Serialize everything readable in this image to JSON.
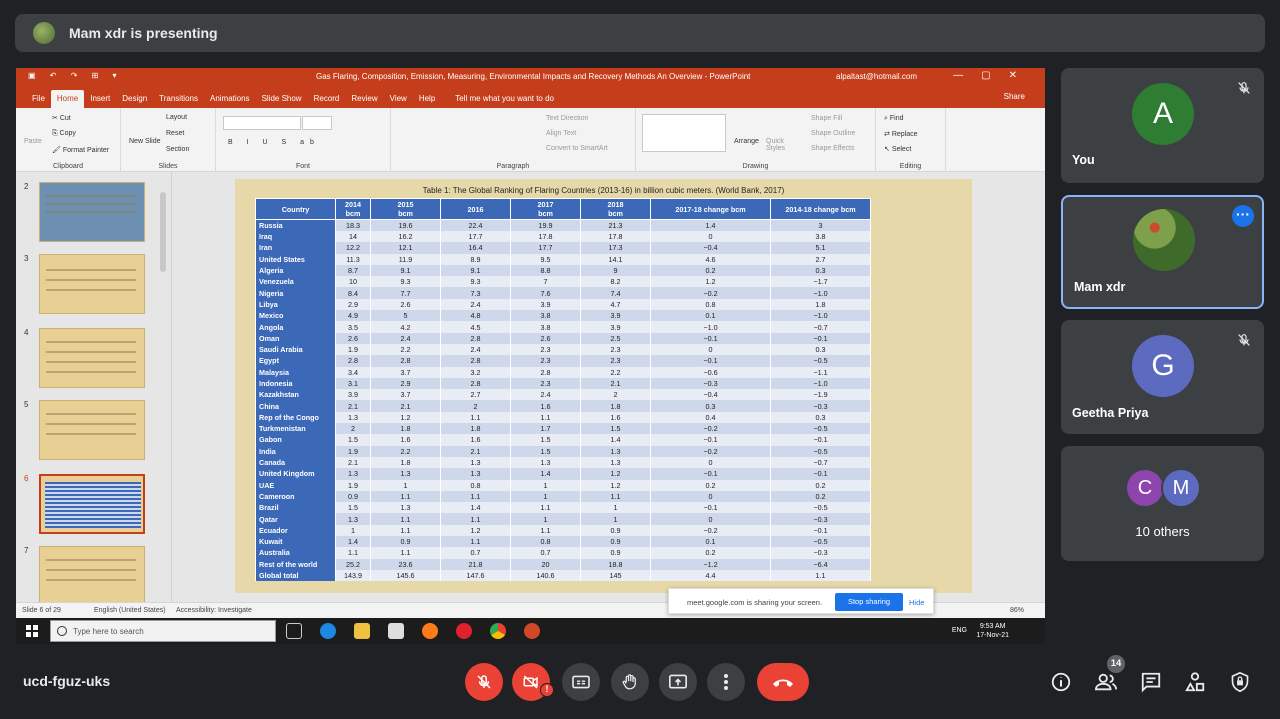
{
  "presenting": {
    "text": "Mam xdr is presenting"
  },
  "ppt": {
    "window_title": "Gas Flaring, Composition, Emission, Measuring, Environmental Impacts and Recovery Methods An Overview  -  PowerPoint",
    "account": "alpaltast@hotmail.com",
    "tabs": [
      "File",
      "Home",
      "Insert",
      "Design",
      "Transitions",
      "Animations",
      "Slide Show",
      "Record",
      "Review",
      "View",
      "Help"
    ],
    "active_tab": "Home",
    "tell_me": "Tell me what you want to do",
    "share": "Share",
    "ribbon": {
      "clipboard": {
        "label": "Clipboard",
        "paste": "Paste",
        "cut": "Cut",
        "copy": "Copy",
        "format_painter": "Format Painter"
      },
      "slides": {
        "label": "Slides",
        "new_slide": "New Slide",
        "layout": "Layout",
        "reset": "Reset",
        "section": "Section"
      },
      "font": {
        "label": "Font"
      },
      "paragraph": {
        "label": "Paragraph",
        "text_direction": "Text Direction",
        "align_text": "Align Text",
        "smartart": "Convert to SmartArt"
      },
      "drawing": {
        "label": "Drawing",
        "arrange": "Arrange",
        "quick_styles": "Quick Styles",
        "shape_fill": "Shape Fill",
        "shape_outline": "Shape Outline",
        "shape_effects": "Shape Effects"
      },
      "editing": {
        "label": "Editing",
        "find": "Find",
        "replace": "Replace",
        "select": "Select"
      }
    },
    "thumbnails": [
      {
        "num": "2"
      },
      {
        "num": "3"
      },
      {
        "num": "4"
      },
      {
        "num": "5"
      },
      {
        "num": "6"
      },
      {
        "num": "7"
      }
    ],
    "selected_slide": "6",
    "status": {
      "slide": "Slide 6 of 29",
      "language": "English (United States)",
      "accessibility": "Accessibility: Investigate",
      "zoom": "86%"
    }
  },
  "slide": {
    "table_title": "Table 1: The Global Ranking of Flaring Countries (2013-16) in billion cubic meters. (World Bank, 2017)",
    "headers": [
      "Country",
      "2014\nbcm",
      "2015\nbcm",
      "2016",
      "2017\nbcm",
      "2018\nbcm",
      "2017-18 change bcm",
      "2014-18 change bcm"
    ],
    "rows": [
      [
        "Russia",
        "18.3",
        "19.6",
        "22.4",
        "19.9",
        "21.3",
        "1.4",
        "3"
      ],
      [
        "Iraq",
        "14",
        "16.2",
        "17.7",
        "17.8",
        "17.8",
        "0",
        "3.8"
      ],
      [
        "Iran",
        "12.2",
        "12.1",
        "16.4",
        "17.7",
        "17.3",
        "−0.4",
        "5.1"
      ],
      [
        "United States",
        "11.3",
        "11.9",
        "8.9",
        "9.5",
        "14.1",
        "4.6",
        "2.7"
      ],
      [
        "Algeria",
        "8.7",
        "9.1",
        "9.1",
        "8.8",
        "9",
        "0.2",
        "0.3"
      ],
      [
        "Venezuela",
        "10",
        "9.3",
        "9.3",
        "7",
        "8.2",
        "1.2",
        "−1.7"
      ],
      [
        "Nigeria",
        "8.4",
        "7.7",
        "7.3",
        "7.6",
        "7.4",
        "−0.2",
        "−1.0"
      ],
      [
        "Libya",
        "2.9",
        "2.6",
        "2.4",
        "3.9",
        "4.7",
        "0.8",
        "1.8"
      ],
      [
        "Mexico",
        "4.9",
        "5",
        "4.8",
        "3.8",
        "3.9",
        "0.1",
        "−1.0"
      ],
      [
        "Angola",
        "3.5",
        "4.2",
        "4.5",
        "3.8",
        "3.9",
        "−1.0",
        "−0.7"
      ],
      [
        "Oman",
        "2.6",
        "2.4",
        "2.8",
        "2.6",
        "2.5",
        "−0.1",
        "−0.1"
      ],
      [
        "Saudi Arabia",
        "1.9",
        "2.2",
        "2.4",
        "2.3",
        "2.3",
        "0",
        "0.3"
      ],
      [
        "Egypt",
        "2.8",
        "2.8",
        "2.8",
        "2.3",
        "2.3",
        "−0.1",
        "−0.5"
      ],
      [
        "Malaysia",
        "3.4",
        "3.7",
        "3.2",
        "2.8",
        "2.2",
        "−0.6",
        "−1.1"
      ],
      [
        "Indonesia",
        "3.1",
        "2.9",
        "2.8",
        "2.3",
        "2.1",
        "−0.3",
        "−1.0"
      ],
      [
        "Kazakhstan",
        "3.9",
        "3.7",
        "2.7",
        "2.4",
        "2",
        "−0.4",
        "−1.9"
      ],
      [
        "China",
        "2.1",
        "2.1",
        "2",
        "1.6",
        "1.8",
        "0.3",
        "−0.3"
      ],
      [
        "Rep of the Congo",
        "1.3",
        "1.2",
        "1.1",
        "1.1",
        "1.6",
        "0.4",
        "0.3"
      ],
      [
        "Turkmenistan",
        "2",
        "1.8",
        "1.8",
        "1.7",
        "1.5",
        "−0.2",
        "−0.5"
      ],
      [
        "Gabon",
        "1.5",
        "1.6",
        "1.6",
        "1.5",
        "1.4",
        "−0.1",
        "−0.1"
      ],
      [
        "India",
        "1.9",
        "2.2",
        "2.1",
        "1.5",
        "1.3",
        "−0.2",
        "−0.5"
      ],
      [
        "Canada",
        "2.1",
        "1.8",
        "1.3",
        "1.3",
        "1.3",
        "0",
        "−0.7"
      ],
      [
        "United Kingdom",
        "1.3",
        "1.3",
        "1.3",
        "1.4",
        "1.2",
        "−0.1",
        "−0.1"
      ],
      [
        "UAE",
        "1.9",
        "1",
        "0.8",
        "1",
        "1.2",
        "0.2",
        "0.2"
      ],
      [
        "Cameroon",
        "0.9",
        "1.1",
        "1.1",
        "1",
        "1.1",
        "0",
        "0.2"
      ],
      [
        "Brazil",
        "1.5",
        "1.3",
        "1.4",
        "1.1",
        "1",
        "−0.1",
        "−0.5"
      ],
      [
        "Qatar",
        "1.3",
        "1.1",
        "1.1",
        "1",
        "1",
        "0",
        "−0.3"
      ],
      [
        "Ecuador",
        "1",
        "1.1",
        "1.2",
        "1.1",
        "0.9",
        "−0.2",
        "−0.1"
      ],
      [
        "Kuwait",
        "1.4",
        "0.9",
        "1.1",
        "0.8",
        "0.9",
        "0.1",
        "−0.5"
      ],
      [
        "Australia",
        "1.1",
        "1.1",
        "0.7",
        "0.7",
        "0.9",
        "0.2",
        "−0.3"
      ],
      [
        "Rest of the world",
        "25.2",
        "23.6",
        "21.8",
        "20",
        "18.8",
        "−1.2",
        "−6.4"
      ],
      [
        "Global total",
        "143.9",
        "145.6",
        "147.6",
        "140.6",
        "145",
        "4.4",
        "1.1"
      ]
    ]
  },
  "share_notice": {
    "text": "meet.google.com is sharing your screen.",
    "stop": "Stop sharing",
    "hide": "Hide"
  },
  "taskbar": {
    "search_placeholder": "Type here to search",
    "time": "9:53 AM",
    "date": "17-Nov-21",
    "lang": "ENG"
  },
  "participants": [
    {
      "name": "You",
      "initial": "A",
      "color": "#2e7d32",
      "muted": true
    },
    {
      "name": "Mam xdr",
      "initial": "",
      "color": "#6a8c3a",
      "muted": false
    },
    {
      "name": "Geetha Priya",
      "initial": "G",
      "color": "#5c6bc0",
      "muted": true
    }
  ],
  "others": {
    "label": "10 others",
    "initials": [
      "C",
      "M"
    ],
    "colors": [
      "#8e44ad",
      "#5c6bc0"
    ]
  },
  "meeting": {
    "code": "ucd-fguz-uks",
    "people_count": "14"
  }
}
